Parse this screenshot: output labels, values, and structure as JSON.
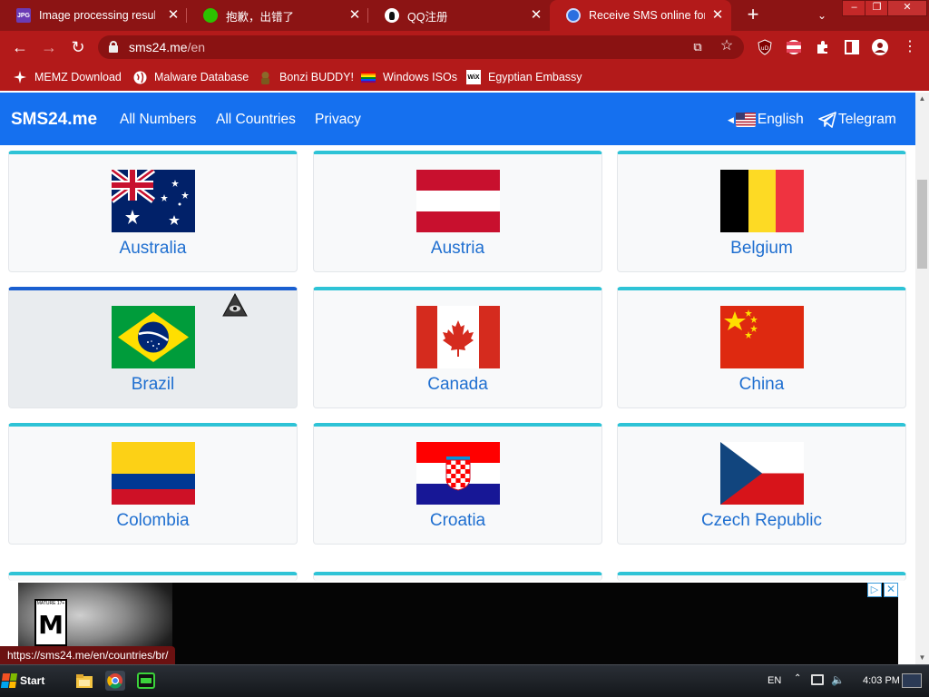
{
  "browser": {
    "tabs": [
      {
        "label": "Image processing result - ",
        "favicon": "jpg-icon",
        "active": false
      },
      {
        "label": "抱歉，出错了",
        "favicon": "wechat-icon",
        "active": false
      },
      {
        "label": "QQ注册",
        "favicon": "qq-penguin-icon",
        "active": false
      },
      {
        "label": "Receive SMS online for fr",
        "favicon": "sms24-icon",
        "active": true
      }
    ],
    "address": {
      "domain": "sms24.me",
      "path": "/en"
    },
    "bookmarks": [
      {
        "label": "MEMZ Download",
        "icon": "memz-icon"
      },
      {
        "label": "Malware Database",
        "icon": "globe-icon"
      },
      {
        "label": "Bonzi BUDDY!",
        "icon": "bonzi-icon"
      },
      {
        "label": "Windows ISOs",
        "icon": "rainbow-flag-icon"
      },
      {
        "label": "Egyptian Embassy",
        "icon": "wix-icon"
      }
    ],
    "status_url": "https://sms24.me/en/countries/br/"
  },
  "site": {
    "brand": "SMS24.me",
    "nav": [
      "All Numbers",
      "All Countries",
      "Privacy"
    ],
    "language": "English",
    "telegram": "Telegram"
  },
  "countries": [
    {
      "name": "Australia",
      "flag": "australia-flag"
    },
    {
      "name": "Austria",
      "flag": "austria-flag"
    },
    {
      "name": "Belgium",
      "flag": "belgium-flag"
    },
    {
      "name": "Brazil",
      "flag": "brazil-flag",
      "hovered": true
    },
    {
      "name": "Canada",
      "flag": "canada-flag"
    },
    {
      "name": "China",
      "flag": "china-flag"
    },
    {
      "name": "Colombia",
      "flag": "colombia-flag"
    },
    {
      "name": "Croatia",
      "flag": "croatia-flag"
    },
    {
      "name": "Czech Republic",
      "flag": "czech-republic-flag"
    }
  ],
  "ad": {
    "rating_letter": "M",
    "rating_label": "MATURE 17+",
    "choice_glyph": "▷",
    "close_glyph": "✕"
  },
  "taskbar": {
    "start_label": "Start",
    "language": "EN",
    "clock": "4:03 PM"
  },
  "colors": {
    "browser_frame": "#b31a1a",
    "navbar": "#1570ef",
    "card_accent": "#2ec3d6",
    "country_text": "#1f6fd0"
  }
}
